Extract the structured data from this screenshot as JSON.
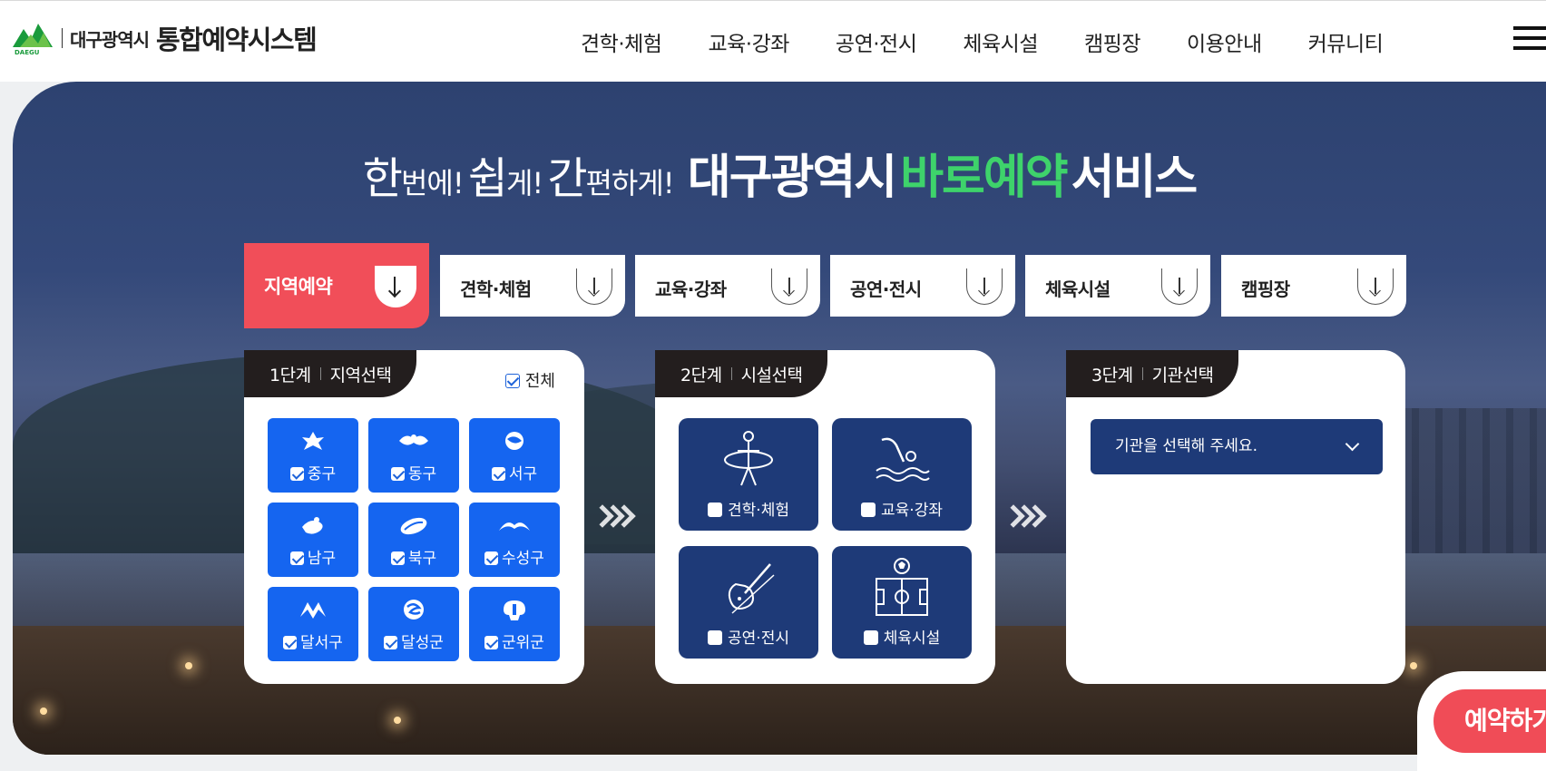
{
  "logo": {
    "emblem_text": "DAEGU",
    "city": "대구광역시",
    "system": "통합예약시스템"
  },
  "nav": {
    "items": [
      "견학·체험",
      "교육·강좌",
      "공연·전시",
      "체육시설",
      "캠핑장",
      "이용안내",
      "커뮤니티"
    ]
  },
  "headline": {
    "p1_big": "한",
    "p1_small": "번에!",
    "p2_big": "쉽",
    "p2_small": "게!",
    "p3_big": "간",
    "p3_small": "편하게!",
    "main_white": "대구광역시",
    "main_green": "바로예약",
    "main_end": "서비스"
  },
  "tabs": [
    "지역예약",
    "견학·체험",
    "교육·강좌",
    "공연·전시",
    "체육시설",
    "캠핑장"
  ],
  "step1": {
    "step": "1단계",
    "title": "지역선택",
    "all_label": "전체",
    "regions": [
      "중구",
      "동구",
      "서구",
      "남구",
      "북구",
      "수성구",
      "달서구",
      "달성군",
      "군위군"
    ]
  },
  "step2": {
    "step": "2단계",
    "title": "시설선택",
    "facilities": [
      "견학·체험",
      "교육·강좌",
      "공연·전시",
      "체육시설"
    ]
  },
  "step3": {
    "step": "3단계",
    "title": "기관선택",
    "select_placeholder": "기관을 선택해 주세요."
  },
  "reserve_button": "예약하기",
  "colors": {
    "accent_red": "#f14e59",
    "region_blue": "#1565f0",
    "navy": "#1e3a78",
    "green": "#3ed36b"
  }
}
